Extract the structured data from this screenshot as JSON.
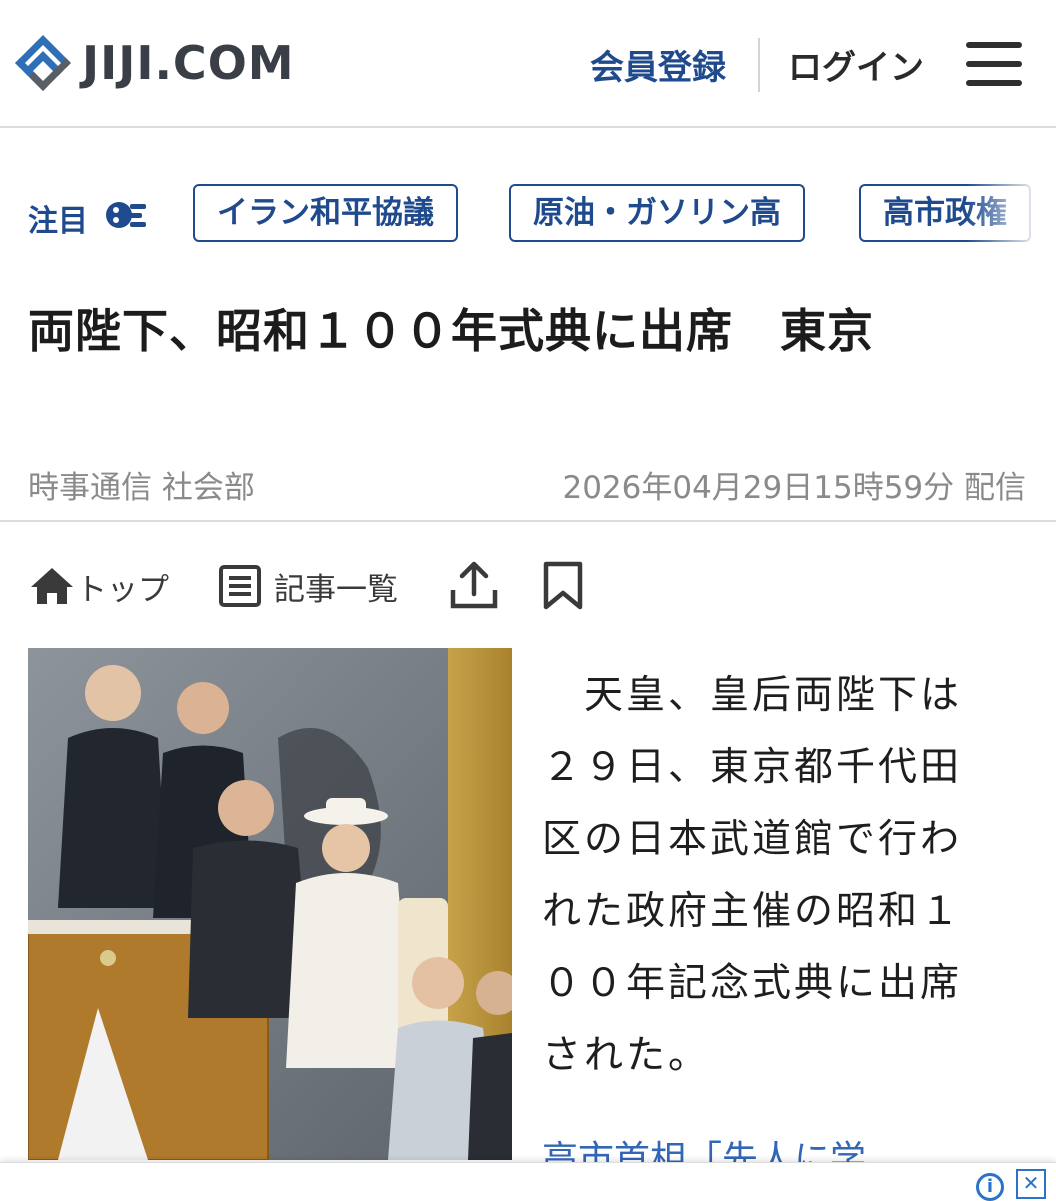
{
  "header": {
    "logo_text": "JIJI.COM",
    "signup_label": "会員登録",
    "login_label": "ログイン",
    "brand_color": "#1f4b8e"
  },
  "topics": {
    "label": "注目",
    "items": [
      "イラン和平協議",
      "原油・ガソリン高",
      "高市政権"
    ]
  },
  "article": {
    "title": "両陛下、昭和１００年式典に出席　東京",
    "source": "時事通信 社会部",
    "date": "2026年04月29日15時59分 配信",
    "body": "　天皇、皇后両陛下は２９日、東京都千代田区の日本武道館で行われた政府主催の昭和１００年記念式典に出席された。",
    "related_link": "高市首相「先人に学"
  },
  "toolbar": {
    "top_label": "トップ",
    "list_label": "記事一覧"
  },
  "icons": [
    "jiji-logo-icon",
    "menu-icon",
    "topics-icon",
    "home-icon",
    "list-icon",
    "share-icon",
    "bookmark-icon",
    "info-icon",
    "close-icon"
  ]
}
